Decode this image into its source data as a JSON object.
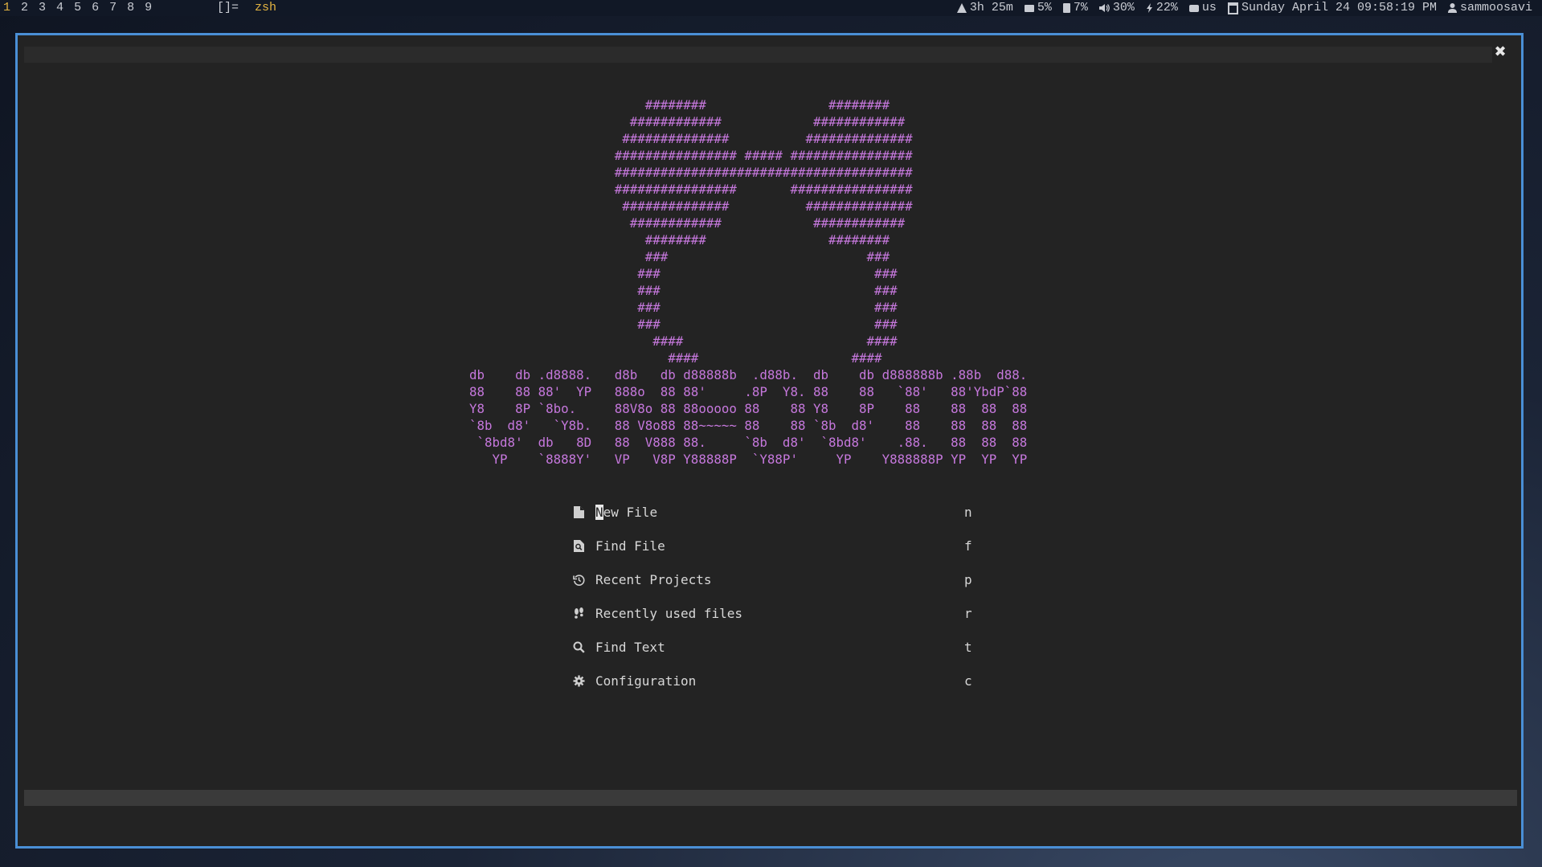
{
  "topbar": {
    "workspaces": [
      "1",
      "2",
      "3",
      "4",
      "5",
      "6",
      "7",
      "8",
      "9"
    ],
    "active_workspace": "1",
    "layout_symbol": "[]=",
    "window_title": "zsh",
    "status": {
      "uptime": "3h 25m",
      "ram": "5%",
      "disk": "7%",
      "volume": "30%",
      "battery": "22%",
      "keyboard": "us",
      "datetime": "Sunday April 24 09:58:19 PM",
      "user": "sammoosavi"
    },
    "status_icons": [
      "uptime-icon",
      "ram-icon",
      "disk-icon",
      "volume-icon",
      "battery-bolt-icon",
      "keyboard-icon",
      "calendar-icon",
      "user-icon"
    ]
  },
  "window": {
    "close_label": "✖",
    "banner": "                       ########                ########\n                     ############            ############\n                    ##############          ##############\n                   ################ ##### ################\n                   #######################################\n                   ################       ################\n                    ##############          ##############\n                     ############            ############\n                       ########                ########\n                       ###                          ###\n                      ###                            ###\n                      ###                            ###\n                      ###                            ###\n                      ###                            ###\n                        ####                        ####\n                          ####                    ####\ndb    db .d8888.   d8b   db d88888b  .d88b.  db    db d888888b .88b  d88.\n88    88 88'  YP   888o  88 88'     .8P  Y8. 88    88   `88'   88'YbdP`88\nY8    8P `8bo.     88V8o 88 88ooooo 88    88 Y8    8P    88    88  88  88\n`8b  d8'   `Y8b.   88 V8o88 88~~~~~ 88    88 `8b  d8'    88    88  88  88\n `8bd8'  db   8D   88  V888 88.     `8b  d8'  `8bd8'    .88.   88  88  88\n   YP    `8888Y'   VP   V8P Y88888P  `Y88P'     YP    Y888888P YP  YP  YP",
    "accent_color": "#c678dd",
    "border_color": "#4a8fd6"
  },
  "menu": {
    "items": [
      {
        "icon": "file-icon",
        "label_first": "N",
        "label_rest": "ew File",
        "key": "n"
      },
      {
        "icon": "find-file-icon",
        "label": "Find File",
        "key": "f"
      },
      {
        "icon": "history-icon",
        "label": "Recent Projects",
        "key": "p"
      },
      {
        "icon": "footprints-icon",
        "label": "Recently used files",
        "key": "r"
      },
      {
        "icon": "search-icon",
        "label": "Find Text",
        "key": "t"
      },
      {
        "icon": "gear-icon",
        "label": "Configuration",
        "key": "c"
      }
    ]
  }
}
